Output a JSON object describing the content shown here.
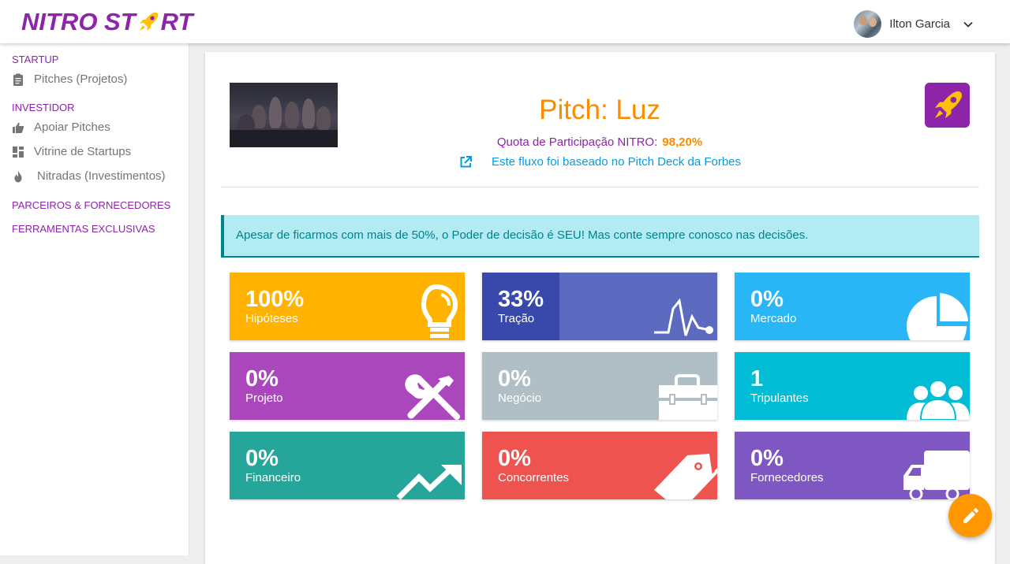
{
  "app": {
    "logo_text_left": "NITRO ST",
    "logo_text_right": "RT"
  },
  "user": {
    "name": "Ilton Garcia"
  },
  "sidebar": {
    "sections": [
      {
        "label": "STARTUP",
        "items": [
          {
            "label": "Pitches (Projetos)",
            "icon": "clipboard-icon"
          }
        ]
      },
      {
        "label": "INVESTIDOR",
        "items": [
          {
            "label": "Apoiar Pitches",
            "icon": "thumbs-up-icon"
          },
          {
            "label": "Vitrine de Startups",
            "icon": "dashboard-icon"
          },
          {
            "label": "Nitradas (Investimentos)",
            "icon": "flame-icon"
          }
        ]
      },
      {
        "label": "PARCEIROS & FORNECEDORES",
        "items": []
      },
      {
        "label": "FERRAMENTAS EXCLUSIVAS",
        "items": []
      }
    ]
  },
  "pitch": {
    "title": "Pitch: Luz",
    "quota_label": "Quota de Participação NITRO:",
    "quota_value": "98,20%",
    "forbes_link": "Este fluxo foi baseado no Pitch Deck da Forbes"
  },
  "alert": {
    "text": "Apesar de ficarmos com mais de 50%, o Poder de decisão é SEU! Mas conte sempre conosco nas decisões."
  },
  "tiles": [
    {
      "value": "100%",
      "label": "Hipóteses",
      "color": "#ffb300",
      "icon": "lightbulb-icon"
    },
    {
      "value": "33%",
      "label": "Tração",
      "color": "#5c6bc0",
      "fill_color": "#3949ab",
      "progress": 0.33,
      "icon": "pulse-icon"
    },
    {
      "value": "0%",
      "label": "Mercado",
      "color": "#29b6f6",
      "icon": "pie-chart-icon"
    },
    {
      "value": "0%",
      "label": "Projeto",
      "color": "#ab47bc",
      "icon": "tools-icon"
    },
    {
      "value": "0%",
      "label": "Negócio",
      "color": "#b0bec5",
      "icon": "briefcase-icon"
    },
    {
      "value": "1",
      "label": "Tripulantes",
      "color": "#00bcd4",
      "icon": "people-icon"
    },
    {
      "value": "0%",
      "label": "Financeiro",
      "color": "#26a69a",
      "icon": "trending-up-icon"
    },
    {
      "value": "0%",
      "label": "Concorrentes",
      "color": "#ef5350",
      "icon": "tag-icon"
    },
    {
      "value": "0%",
      "label": "Fornecedores",
      "color": "#7e57c2",
      "icon": "truck-icon"
    }
  ],
  "fab": {
    "icon": "pencil-icon"
  }
}
